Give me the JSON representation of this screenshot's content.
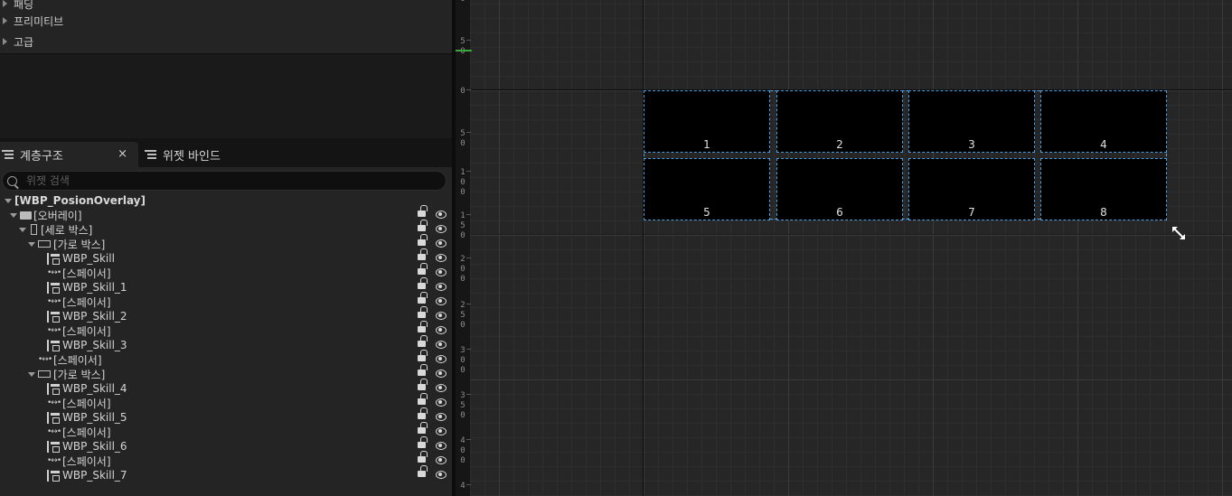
{
  "details": {
    "categories": [
      {
        "label": "패딩"
      },
      {
        "label": "프리미티브"
      },
      {
        "label": "고급"
      }
    ]
  },
  "hierarchy": {
    "tabs": [
      {
        "label": "계층구조",
        "active": true,
        "closable": true
      },
      {
        "label": "위젯 바인드",
        "active": false,
        "closable": false
      }
    ],
    "close_symbol": "×",
    "search": {
      "placeholder": "위젯 검색",
      "value": ""
    },
    "tree": [
      {
        "label": "[WBP_PosionOverlay]",
        "icon": "",
        "expanded": true,
        "root": true
      },
      {
        "label": "[오버레이]",
        "icon": "overlay-icon",
        "expanded": true
      },
      {
        "label": "[세로 박스]",
        "icon": "vertical-box-icon",
        "expanded": true
      },
      {
        "label": "[가로 박스]",
        "icon": "horizontal-box-icon",
        "expanded": true
      },
      {
        "label": "WBP_Skill",
        "icon": "user-widget-icon"
      },
      {
        "label": "[스페이서]",
        "icon": "spacer-icon"
      },
      {
        "label": "WBP_Skill_1",
        "icon": "user-widget-icon"
      },
      {
        "label": "[스페이서]",
        "icon": "spacer-icon"
      },
      {
        "label": "WBP_Skill_2",
        "icon": "user-widget-icon"
      },
      {
        "label": "[스페이서]",
        "icon": "spacer-icon"
      },
      {
        "label": "WBP_Skill_3",
        "icon": "user-widget-icon"
      },
      {
        "label": "[스페이서]",
        "icon": "spacer-icon"
      },
      {
        "label": "[가로 박스]",
        "icon": "horizontal-box-icon",
        "expanded": true
      },
      {
        "label": "WBP_Skill_4",
        "icon": "user-widget-icon"
      },
      {
        "label": "[스페이서]",
        "icon": "spacer-icon"
      },
      {
        "label": "WBP_Skill_5",
        "icon": "user-widget-icon"
      },
      {
        "label": "[스페이서]",
        "icon": "spacer-icon"
      },
      {
        "label": "WBP_Skill_6",
        "icon": "user-widget-icon"
      },
      {
        "label": "[스페이서]",
        "icon": "spacer-icon"
      },
      {
        "label": "WBP_Skill_7",
        "icon": "user-widget-icon"
      }
    ]
  },
  "designer": {
    "ruler_ticks": [
      "0",
      "50",
      "0",
      "50",
      "100",
      "150",
      "200",
      "250",
      "300",
      "350",
      "400",
      "4"
    ],
    "slots": [
      "1",
      "2",
      "3",
      "4",
      "5",
      "6",
      "7",
      "8"
    ],
    "selection_color": "#5fb0e8"
  }
}
